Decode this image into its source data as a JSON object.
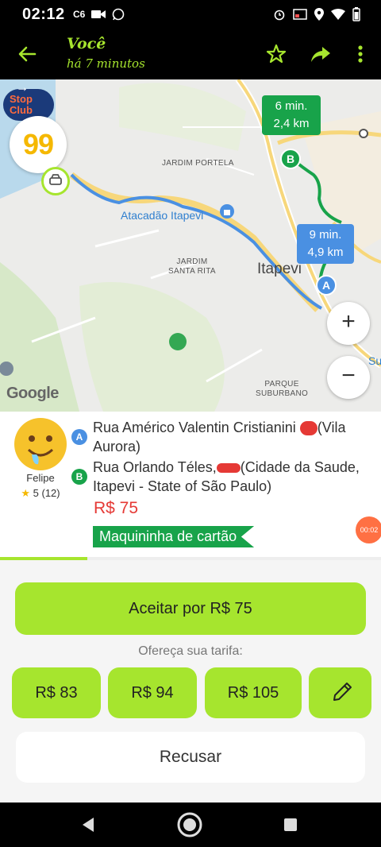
{
  "status_bar": {
    "time": "02:12",
    "notif_text": "C6"
  },
  "header": {
    "title": "Você",
    "subtitle": "há 7 minutos"
  },
  "map": {
    "labels": {
      "jardim_portela": "JARDIM PORTELA",
      "atacadao": "Atacadão Itapevi",
      "jardim_santa_rita": "JARDIM\nSANTA RITA",
      "itapevi": "Itapevi",
      "parque_suburbano": "PARQUE\nSUBURBANO",
      "edge_label": "Su",
      "google": "Google"
    },
    "route_b": {
      "time": "6 min.",
      "distance": "2,4 km"
    },
    "route_a": {
      "time": "9 min.",
      "distance": "4,9 km"
    },
    "badge": "99",
    "promo_badge": "Stop\nClub",
    "zoom_in": "+",
    "zoom_out": "−"
  },
  "ride": {
    "driver_name": "Felipe",
    "rating": "5 (12)",
    "pickup": "Rua Américo Valentin Cristianini",
    "pickup_suffix": "(Vila Aurora)",
    "dropoff": "Rua Orlando Téles,",
    "dropoff_suffix": "(Cidade da Saude, Itapevi - State of São Paulo)",
    "price": "R$ 75",
    "payment": "Maquininha de cartão",
    "timer": "00:02",
    "progress_fraction": 0.23
  },
  "actions": {
    "accept": "Aceitar por R$ 75",
    "offer_label": "Ofereça sua tarifa:",
    "fares": [
      "R$ 83",
      "R$ 94",
      "R$ 105"
    ],
    "decline": "Recusar"
  },
  "colors": {
    "accent": "#a6e52e",
    "route_green": "#18a34a",
    "route_blue": "#4a90e2",
    "price_red": "#e53935"
  }
}
